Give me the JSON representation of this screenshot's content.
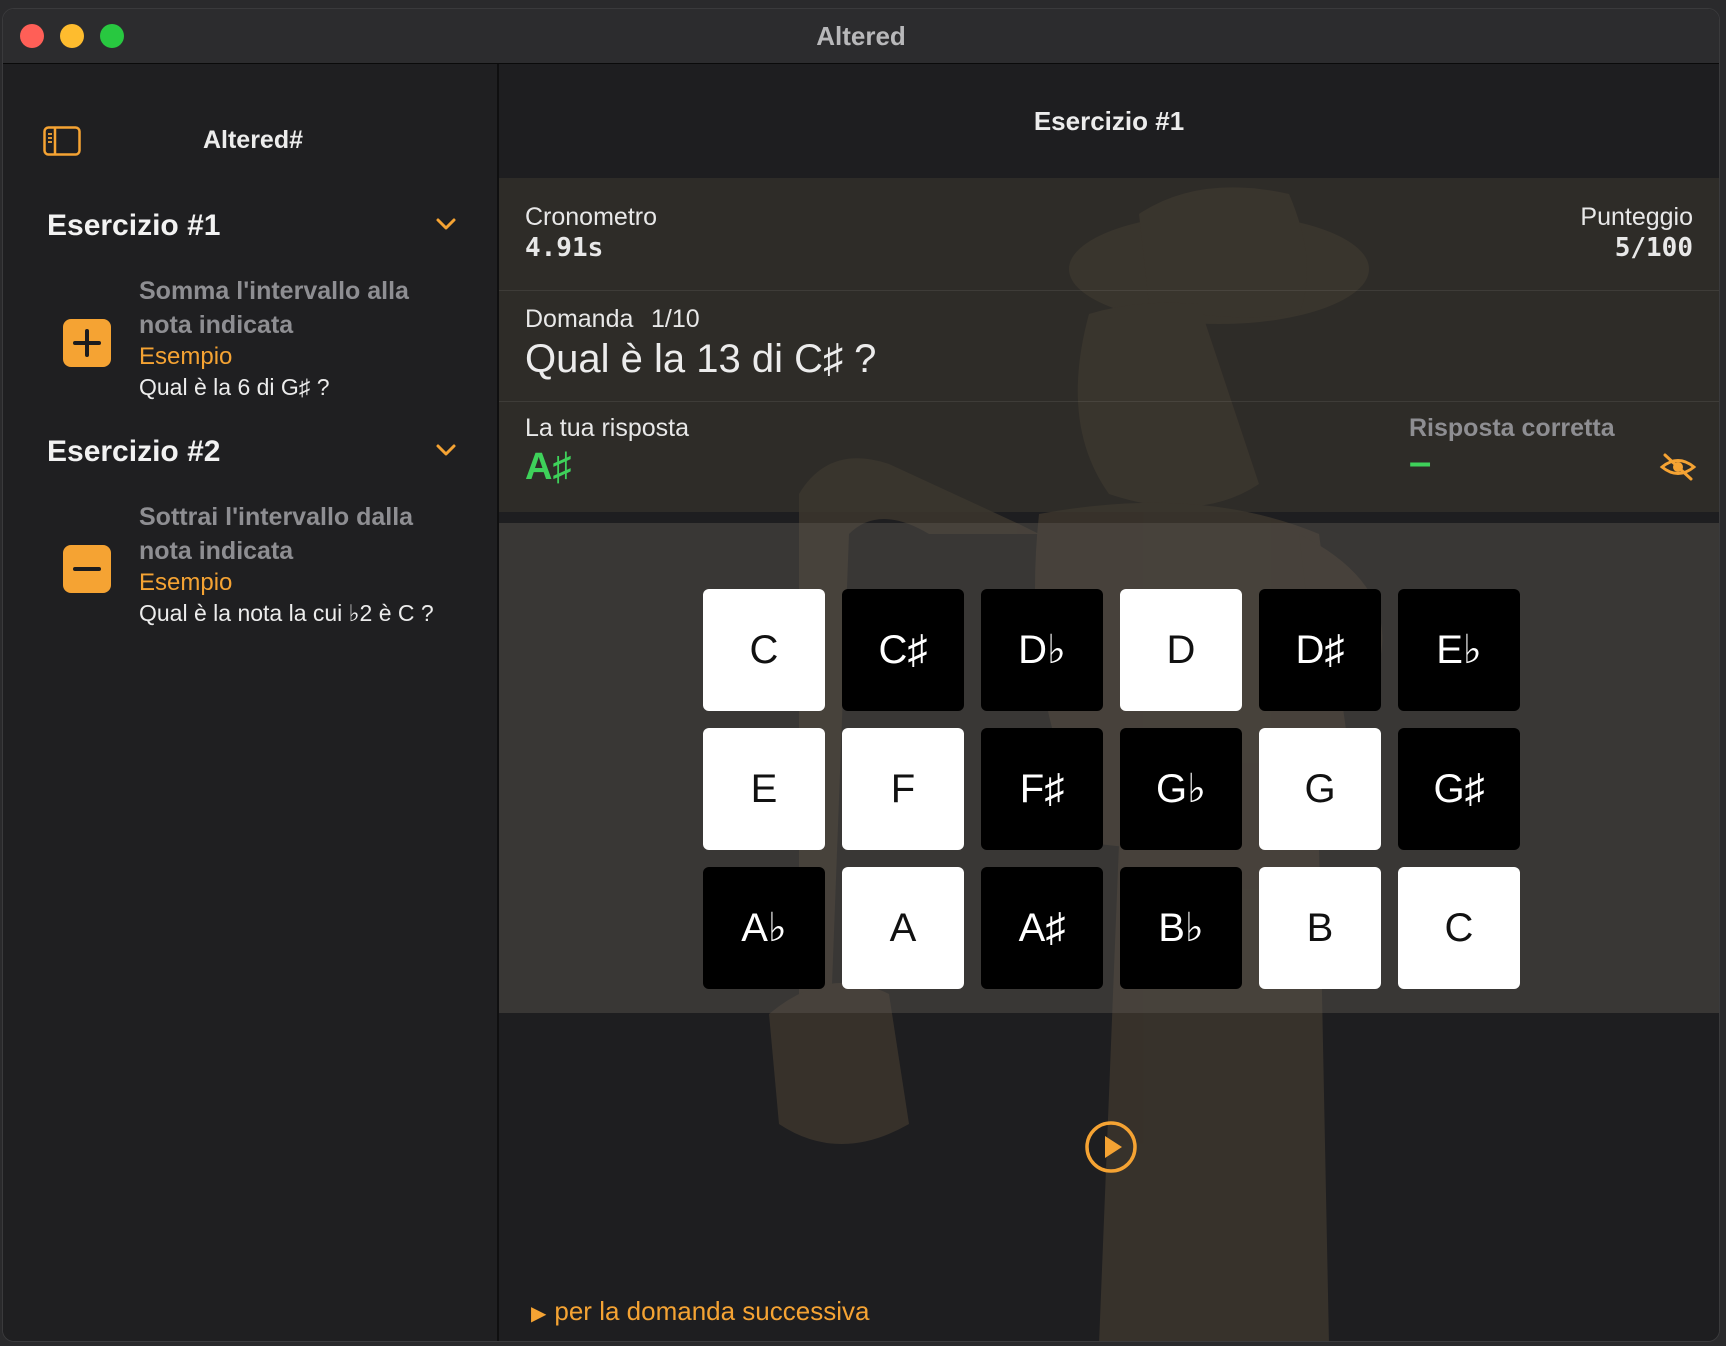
{
  "window": {
    "title": "Altered"
  },
  "sidebar": {
    "app_name": "Altered#",
    "sections": [
      {
        "title": "Esercizio #1",
        "description": "Somma l'intervallo alla nota indicata",
        "example_label": "Esempio",
        "example": "Qual è la 6 di G♯ ?",
        "icon": "plus-icon"
      },
      {
        "title": "Esercizio #2",
        "description": "Sottrai l'intervallo dalla nota indicata",
        "example_label": "Esempio",
        "example": "Qual è la nota la cui ♭2 è C ?",
        "icon": "minus-icon"
      }
    ]
  },
  "main": {
    "title": "Esercizio #1",
    "timer_label": "Cronometro",
    "timer_value": "4.91s",
    "score_label": "Punteggio",
    "score_value": "5/100",
    "question_label": "Domanda",
    "question_index": "1/10",
    "question_text": "Qual è la 13 di C♯ ?",
    "your_answer_label": "La tua risposta",
    "your_answer_value": "A♯",
    "correct_answer_label": "Risposta corretta",
    "correct_answer_value": "–",
    "next_hint": "per la domanda successiva",
    "accent_color": "#f5a333",
    "answer_color": "#3ed15a"
  },
  "keys": [
    [
      {
        "label": "C",
        "color": "white"
      },
      {
        "label": "C♯",
        "color": "black"
      },
      {
        "label": "D♭",
        "color": "black"
      },
      {
        "label": "D",
        "color": "white"
      },
      {
        "label": "D♯",
        "color": "black"
      },
      {
        "label": "E♭",
        "color": "black"
      }
    ],
    [
      {
        "label": "E",
        "color": "white"
      },
      {
        "label": "F",
        "color": "white"
      },
      {
        "label": "F♯",
        "color": "black"
      },
      {
        "label": "G♭",
        "color": "black"
      },
      {
        "label": "G",
        "color": "white"
      },
      {
        "label": "G♯",
        "color": "black"
      }
    ],
    [
      {
        "label": "A♭",
        "color": "black"
      },
      {
        "label": "A",
        "color": "white"
      },
      {
        "label": "A♯",
        "color": "black"
      },
      {
        "label": "B♭",
        "color": "black"
      },
      {
        "label": "B",
        "color": "white"
      },
      {
        "label": "C",
        "color": "white"
      }
    ]
  ]
}
